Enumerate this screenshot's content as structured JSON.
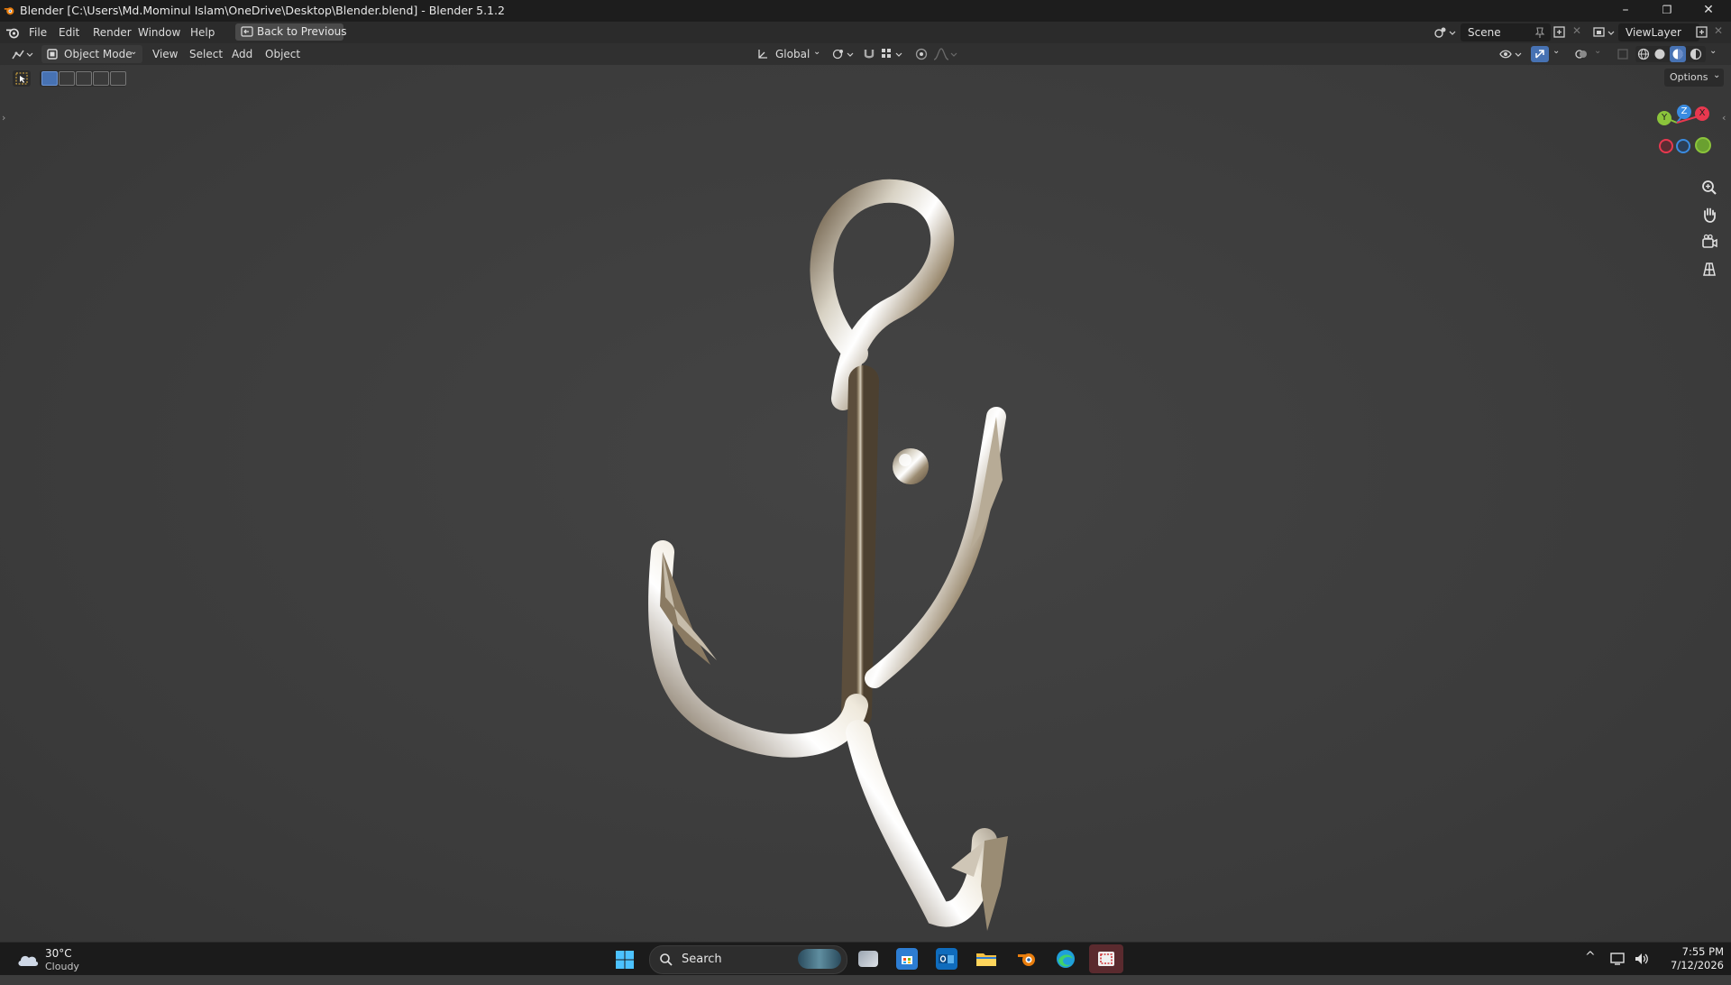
{
  "titlebar": {
    "title": "Blender [C:\\Users\\Md.Mominul Islam\\OneDrive\\Desktop\\Blender.blend] - Blender 5.1.2",
    "minimize": "–",
    "maximize": "❐",
    "close": "✕"
  },
  "menubar": {
    "items": [
      "File",
      "Edit",
      "Render",
      "Window",
      "Help"
    ],
    "back_label": "Back to Previous",
    "scene_name": "Scene",
    "view_layer": "ViewLayer"
  },
  "viewport_header": {
    "mode": "Object Mode",
    "menus": [
      "View",
      "Select",
      "Add",
      "Object"
    ],
    "orientation": "Global",
    "options_label": "Options"
  },
  "gizmo": {
    "x_label": "X",
    "y_label": "Y",
    "z_label": "Z",
    "x_color": "#e8384f",
    "y_color": "#8bc43b",
    "z_color": "#3a8be0"
  },
  "taskbar": {
    "weather_temp": "30°C",
    "weather_desc": "Cloudy",
    "search_label": "Search",
    "time": "7:55 PM",
    "date": "7/12/2026"
  },
  "colors": {
    "accent": "#4772b3",
    "blender_orange": "#e87d0d"
  }
}
